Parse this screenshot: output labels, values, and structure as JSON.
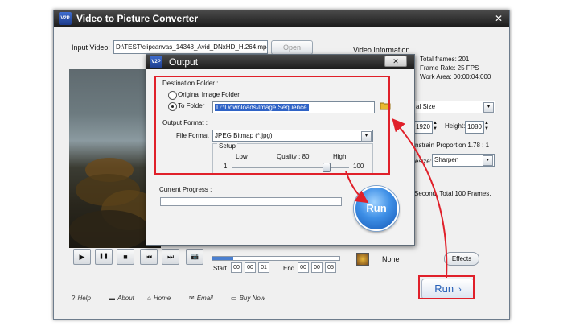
{
  "main": {
    "title": "Video to Picture Converter",
    "logo_text": "V2P",
    "close_glyph": "✕",
    "input_video_label": "Input Video:",
    "input_video_value": "D:\\TEST\\clipcanvas_14348_Avid_DNxHD_H.264.mp4",
    "open_label": "Open",
    "video_info": {
      "title": "Video Information",
      "total_frames": "Total frames: 201",
      "frame_rate": "Frame Rate: 25 FPS",
      "work_area": "Work Area: 00:00:04:000"
    },
    "settings": {
      "size_value": "al Size",
      "width_value": "1920",
      "height_label": "Height:",
      "height_value": "1080",
      "constrain_text": "nstrain Proportion  1.78 : 1",
      "resize_label": "esize:",
      "resize_value": "Sharpen",
      "summary_text": "Second. Total:100 Frames."
    },
    "playback": {
      "play_glyph": "▶",
      "pause_glyph": "❚❚",
      "stop_glyph": "■",
      "prev_glyph": "⏮",
      "next_glyph": "⏭",
      "snapshot_glyph": "📷",
      "start_label": "Start",
      "start_h": "00",
      "start_m": "00",
      "start_s": "01",
      "end_label": "End",
      "end_h": "00",
      "end_m": "00",
      "end_s": "05"
    },
    "effects": {
      "name": "None",
      "button": "Effects"
    },
    "bottom_links": {
      "help": "Help",
      "about": "About",
      "home": "Home",
      "email": "Email",
      "buy_now": "Buy Now"
    },
    "run_label": "Run",
    "run_arrow": "›"
  },
  "dialog": {
    "title": "Output",
    "close_glyph": "✕",
    "destination_label": "Destination Folder :",
    "original_image_folder": "Original Image Folder",
    "to_folder": "To Folder",
    "folder_path": "D:\\Downloads\\Image Sequence",
    "output_format_label": "Output Format :",
    "file_format_label": "File Format",
    "file_format_value": "JPEG Bitmap (*.jpg)",
    "setup_label": "Setup",
    "quality_low": "Low",
    "quality_text": "Quality : 80",
    "quality_high": "High",
    "quality_min": "1",
    "quality_max": "100",
    "quality_value": 80,
    "current_progress_label": "Current Progress :",
    "run_label": "Run"
  },
  "colors": {
    "annotation": "#e0202a",
    "accent": "#2760b8"
  },
  "icons": {
    "help": "question-icon",
    "about": "about-icon",
    "home": "home-icon",
    "email": "email-icon",
    "buy": "cart-icon",
    "folder": "folder-icon"
  }
}
